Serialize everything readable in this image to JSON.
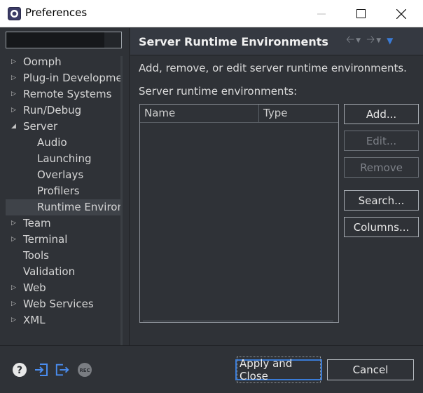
{
  "window": {
    "title": "Preferences"
  },
  "sidebar": {
    "filter_value": "",
    "items": [
      {
        "label": "Oomph",
        "expandable": true,
        "expanded": false,
        "child": false
      },
      {
        "label": "Plug-in Development",
        "expandable": true,
        "expanded": false,
        "child": false
      },
      {
        "label": "Remote Systems",
        "expandable": true,
        "expanded": false,
        "child": false
      },
      {
        "label": "Run/Debug",
        "expandable": true,
        "expanded": false,
        "child": false
      },
      {
        "label": "Server",
        "expandable": true,
        "expanded": true,
        "child": false
      },
      {
        "label": "Audio",
        "expandable": false,
        "child": true
      },
      {
        "label": "Launching",
        "expandable": false,
        "child": true
      },
      {
        "label": "Overlays",
        "expandable": false,
        "child": true
      },
      {
        "label": "Profilers",
        "expandable": false,
        "child": true
      },
      {
        "label": "Runtime Environments",
        "expandable": false,
        "child": true,
        "selected": true
      },
      {
        "label": "Team",
        "expandable": true,
        "expanded": false,
        "child": false
      },
      {
        "label": "Terminal",
        "expandable": true,
        "expanded": false,
        "child": false
      },
      {
        "label": "Tools",
        "expandable": false,
        "child": false
      },
      {
        "label": "Validation",
        "expandable": false,
        "child": false
      },
      {
        "label": "Web",
        "expandable": true,
        "expanded": false,
        "child": false
      },
      {
        "label": "Web Services",
        "expandable": true,
        "expanded": false,
        "child": false
      },
      {
        "label": "XML",
        "expandable": true,
        "expanded": false,
        "child": false
      }
    ]
  },
  "page": {
    "title": "Server Runtime Environments",
    "description": "Add, remove, or edit server runtime environments.",
    "list_label": "Server runtime environments:",
    "table": {
      "columns": [
        "Name",
        "Type"
      ],
      "rows": []
    },
    "buttons": {
      "add": "Add...",
      "edit": "Edit...",
      "remove": "Remove",
      "search": "Search...",
      "columns": "Columns..."
    }
  },
  "footer": {
    "apply_close": "Apply and Close",
    "cancel": "Cancel"
  },
  "colors": {
    "accent": "#3a7bd5",
    "background": "#2f3237",
    "header": "#353941"
  }
}
